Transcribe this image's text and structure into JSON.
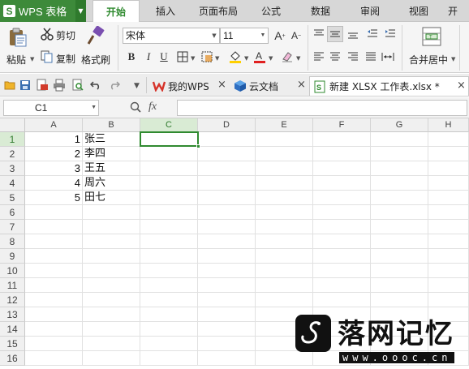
{
  "app": {
    "logo": "S",
    "title": "WPS 表格"
  },
  "menu": {
    "tabs": [
      "开始",
      "插入",
      "页面布局",
      "公式",
      "数据",
      "审阅",
      "视图",
      "开"
    ]
  },
  "ribbon": {
    "paste": "粘贴",
    "cut": "剪切",
    "copy": "复制",
    "format_painter": "格式刷",
    "font_name": "宋体",
    "font_size": "11",
    "merge_center": "合并居中",
    "bold": "B",
    "italic": "I",
    "underline": "U"
  },
  "doc_tabs": {
    "items": [
      {
        "label": "我的WPS",
        "icon": "wps-w-icon"
      },
      {
        "label": "云文档",
        "icon": "cloud-cube-icon"
      },
      {
        "label": "新建 XLSX 工作表.xlsx *",
        "icon": "xlsx-file-icon"
      }
    ]
  },
  "formula_bar": {
    "name_box": "C1",
    "fx": "fx",
    "value": ""
  },
  "sheet": {
    "columns": [
      "A",
      "B",
      "C",
      "D",
      "E",
      "F",
      "G",
      "H"
    ],
    "selected_column": "C",
    "rows": [
      "1",
      "2",
      "3",
      "4",
      "5",
      "6",
      "7",
      "8",
      "9",
      "10",
      "11",
      "12",
      "13",
      "14",
      "15",
      "16"
    ],
    "selected_row": "1",
    "active_cell": "C1",
    "data": [
      {
        "a": "1",
        "b": "张三"
      },
      {
        "a": "2",
        "b": "李四"
      },
      {
        "a": "3",
        "b": "王五"
      },
      {
        "a": "4",
        "b": "周六"
      },
      {
        "a": "5",
        "b": "田七"
      }
    ]
  },
  "watermark": {
    "text": "落网记忆",
    "url": "www.oooc.cn"
  },
  "colors": {
    "accent": "#2f8a2f",
    "titlebar": "#3d8a3a"
  }
}
